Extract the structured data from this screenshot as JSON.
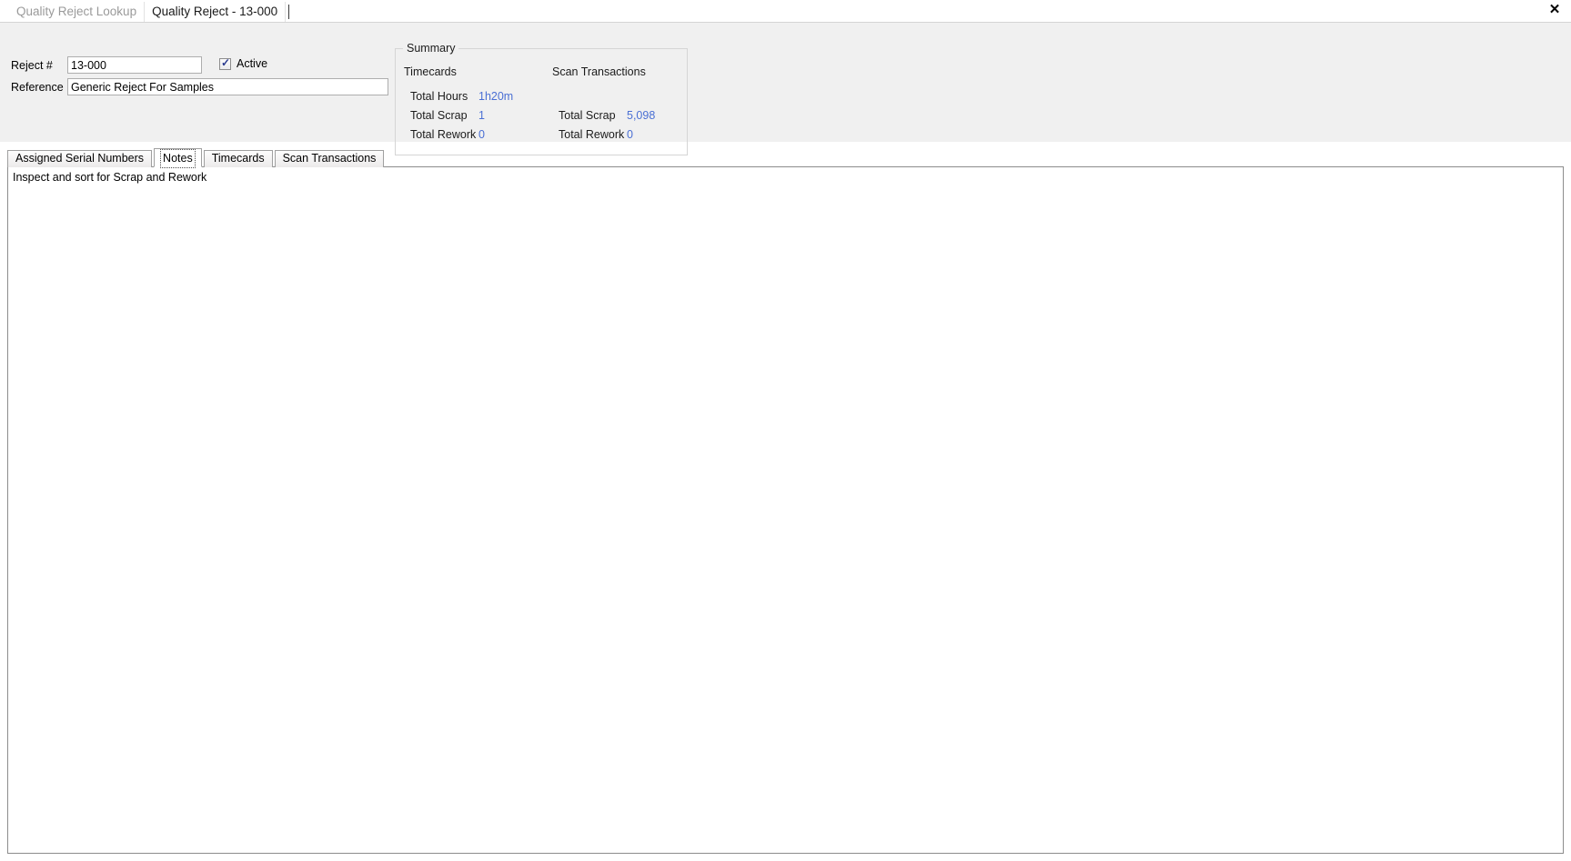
{
  "window": {
    "close_label": "✕"
  },
  "document_tabs": [
    {
      "label": "Quality Reject Lookup",
      "active": false
    },
    {
      "label": "Quality Reject - 13-000",
      "active": true
    }
  ],
  "form": {
    "reject_number_label": "Reject #",
    "reject_number_value": "13-000",
    "reference_label": "Reference",
    "reference_value": "Generic Reject For Samples",
    "active_checkbox_label": "Active",
    "active_checkbox_checked": true,
    "check_glyph": "✓"
  },
  "summary": {
    "title": "Summary",
    "timecards": {
      "heading": "Timecards",
      "rows": [
        {
          "key": "Total Hours",
          "value": "1h20m"
        },
        {
          "key": "Total Scrap",
          "value": "1"
        },
        {
          "key": "Total Rework",
          "value": "0"
        }
      ]
    },
    "scan_transactions": {
      "heading": "Scan Transactions",
      "rows": [
        {
          "key": "Total Scrap",
          "value": "5,098"
        },
        {
          "key": "Total Rework",
          "value": "0"
        }
      ]
    },
    "value_color": "#4a6fd4"
  },
  "detail_tabs": [
    {
      "label": "Assigned Serial Numbers",
      "selected": false
    },
    {
      "label": "Notes",
      "selected": true
    },
    {
      "label": "Timecards",
      "selected": false
    },
    {
      "label": "Scan Transactions",
      "selected": false
    }
  ],
  "notes": {
    "text": "Inspect and sort for Scrap and Rework"
  }
}
